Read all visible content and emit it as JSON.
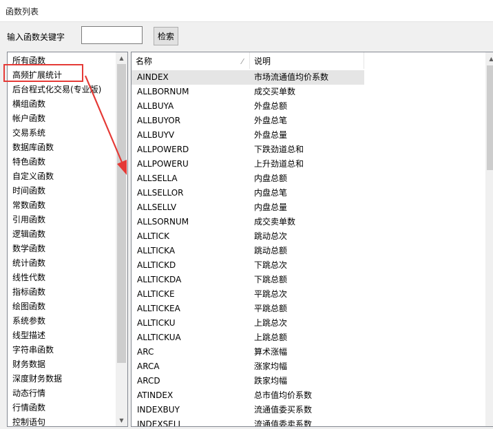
{
  "window": {
    "title": "函数列表"
  },
  "search": {
    "label": "输入函数关键字",
    "value": "",
    "placeholder": "",
    "button_label": "检索"
  },
  "categories": [
    "所有函数",
    "高频扩展统计",
    "后台程式化交易(专业版)",
    "横组函数",
    "帐户函数",
    "交易系统",
    "数据库函数",
    "特色函数",
    "自定义函数",
    "时间函数",
    "常数函数",
    "引用函数",
    "逻辑函数",
    "数学函数",
    "统计函数",
    "线性代数",
    "指标函数",
    "绘图函数",
    "系统参数",
    "线型描述",
    "字符串函数",
    "财务数据",
    "深度财务数据",
    "动态行情",
    "行情函数",
    "控制语句"
  ],
  "highlighted_category_index": 1,
  "table": {
    "headers": {
      "name": "名称",
      "desc": "说明"
    },
    "selected_row_index": 0,
    "rows": [
      {
        "name": "AINDEX",
        "desc": "市场流通值均价系数"
      },
      {
        "name": "ALLBORNUM",
        "desc": "成交买单数"
      },
      {
        "name": "ALLBUYA",
        "desc": "外盘总额"
      },
      {
        "name": "ALLBUYOR",
        "desc": "外盘总笔"
      },
      {
        "name": "ALLBUYV",
        "desc": "外盘总量"
      },
      {
        "name": "ALLPOWERD",
        "desc": "下跌劲道总和"
      },
      {
        "name": "ALLPOWERU",
        "desc": "上升劲道总和"
      },
      {
        "name": "ALLSELLA",
        "desc": "内盘总额"
      },
      {
        "name": "ALLSELLOR",
        "desc": "内盘总笔"
      },
      {
        "name": "ALLSELLV",
        "desc": "内盘总量"
      },
      {
        "name": "ALLSORNUM",
        "desc": "成交卖单数"
      },
      {
        "name": "ALLTICK",
        "desc": "跳动总次"
      },
      {
        "name": "ALLTICKA",
        "desc": "跳动总额"
      },
      {
        "name": "ALLTICKD",
        "desc": "下跳总次"
      },
      {
        "name": "ALLTICKDA",
        "desc": "下跳总额"
      },
      {
        "name": "ALLTICKE",
        "desc": "平跳总次"
      },
      {
        "name": "ALLTICKEA",
        "desc": "平跳总额"
      },
      {
        "name": "ALLTICKU",
        "desc": "上跳总次"
      },
      {
        "name": "ALLTICKUA",
        "desc": "上跳总额"
      },
      {
        "name": "ARC",
        "desc": "算术涨幅"
      },
      {
        "name": "ARCA",
        "desc": "涨家均幅"
      },
      {
        "name": "ARCD",
        "desc": "跌家均幅"
      },
      {
        "name": "ATINDEX",
        "desc": "总市值均价系数"
      },
      {
        "name": "INDEXBUY",
        "desc": "流通值委买系数"
      },
      {
        "name": "INDEXSELL",
        "desc": "流通值委卖系数"
      }
    ]
  },
  "colors": {
    "annotation": "#e53935",
    "selected_row": "#e5e5e5",
    "border": "#828790"
  }
}
